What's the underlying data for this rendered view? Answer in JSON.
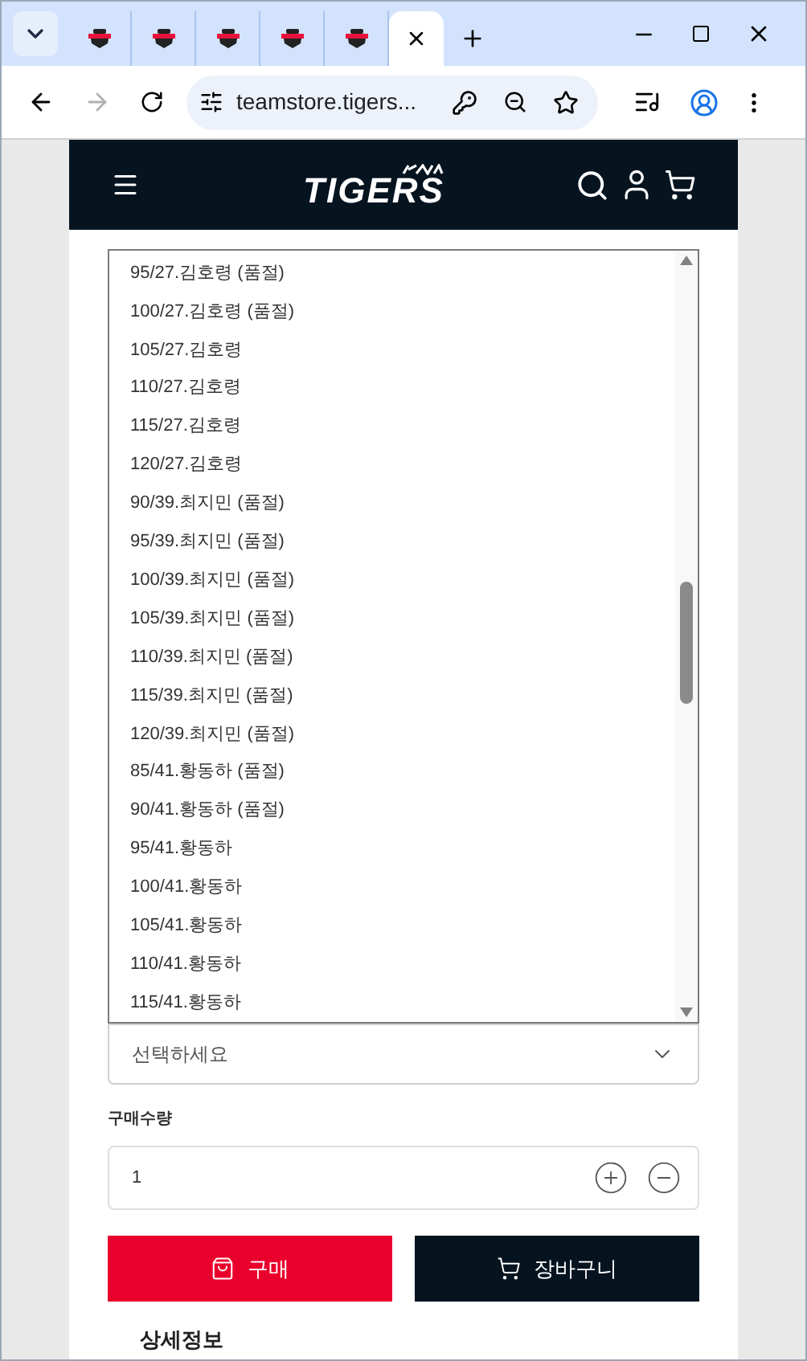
{
  "browser": {
    "tabs": [
      {
        "selected": false
      },
      {
        "selected": false
      },
      {
        "selected": false
      },
      {
        "selected": false
      },
      {
        "selected": false
      },
      {
        "selected": true
      }
    ],
    "address": "teamstore.tigers..."
  },
  "header": {
    "logo": "TIGERS"
  },
  "option_list": {
    "items": [
      "95/27.김호령 (품절)",
      "100/27.김호령 (품절)",
      "105/27.김호령",
      "110/27.김호령",
      "115/27.김호령",
      "120/27.김호령",
      "90/39.최지민 (품절)",
      "95/39.최지민 (품절)",
      "100/39.최지민 (품절)",
      "105/39.최지민 (품절)",
      "110/39.최지민 (품절)",
      "115/39.최지민 (품절)",
      "120/39.최지민 (품절)",
      "85/41.황동하 (품절)",
      "90/41.황동하 (품절)",
      "95/41.황동하",
      "100/41.황동하",
      "105/41.황동하",
      "110/41.황동하",
      "115/41.황동하"
    ]
  },
  "option_select": {
    "placeholder": "선택하세요"
  },
  "quantity": {
    "label": "구매수량",
    "value": "1"
  },
  "buttons": [
    {
      "kind": "buy",
      "label": "구매"
    },
    {
      "kind": "cart",
      "label": "장바구니"
    }
  ],
  "section_title": "상세정보"
}
